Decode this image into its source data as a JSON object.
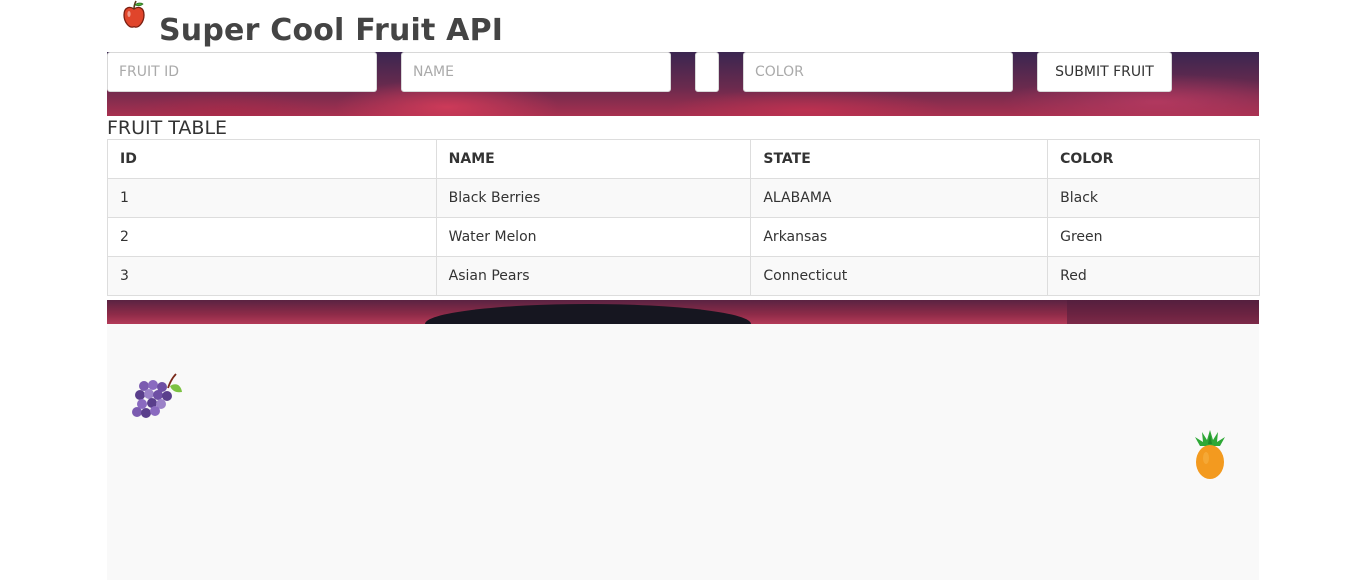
{
  "header": {
    "title": "Super Cool Fruit API",
    "logo_icon": "apple-icon"
  },
  "form": {
    "fruit_id_placeholder": "FRUIT ID",
    "name_placeholder": "NAME",
    "state_placeholder": "",
    "color_placeholder": "COLOR",
    "submit_label": "SUBMIT FRUIT"
  },
  "table": {
    "caption": "FRUIT TABLE",
    "columns": [
      "ID",
      "NAME",
      "STATE",
      "COLOR"
    ],
    "rows": [
      {
        "id": "1",
        "name": "Black Berries",
        "state": "ALABAMA",
        "color": "Black"
      },
      {
        "id": "2",
        "name": "Water Melon",
        "state": "Arkansas",
        "color": "Green"
      },
      {
        "id": "3",
        "name": "Asian Pears",
        "state": "Connecticut",
        "color": "Red"
      }
    ]
  },
  "decorations": {
    "left_icon": "grapes-icon",
    "right_icon": "pineapple-icon"
  },
  "colors": {
    "title": "#444444",
    "table_border": "#dddddd",
    "stripe": "#f9f9f9"
  }
}
